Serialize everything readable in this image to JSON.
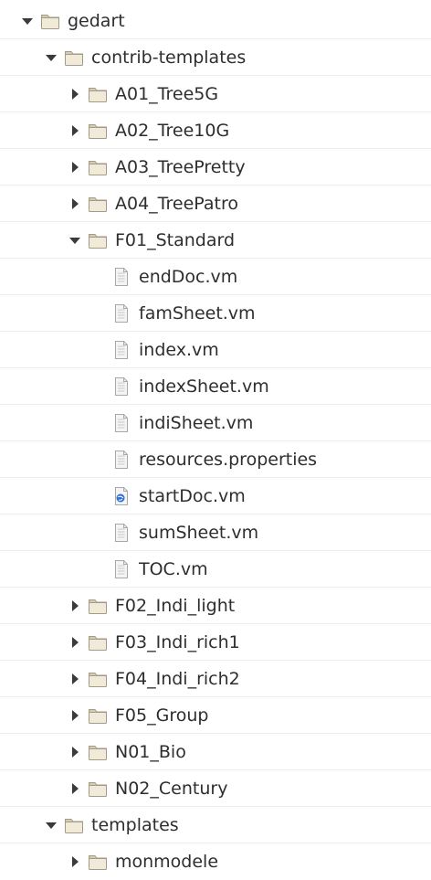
{
  "tree": {
    "items": [
      {
        "label": "gedart",
        "level": 0,
        "kind": "folder",
        "expanded": true,
        "icon": "folder-icon"
      },
      {
        "label": "contrib-templates",
        "level": 1,
        "kind": "folder",
        "expanded": true,
        "icon": "folder-icon"
      },
      {
        "label": "A01_Tree5G",
        "level": 2,
        "kind": "folder",
        "expanded": false,
        "icon": "folder-icon"
      },
      {
        "label": "A02_Tree10G",
        "level": 2,
        "kind": "folder",
        "expanded": false,
        "icon": "folder-icon"
      },
      {
        "label": "A03_TreePretty",
        "level": 2,
        "kind": "folder",
        "expanded": false,
        "icon": "folder-icon"
      },
      {
        "label": "A04_TreePatro",
        "level": 2,
        "kind": "folder",
        "expanded": false,
        "icon": "folder-icon"
      },
      {
        "label": "F01_Standard",
        "level": 2,
        "kind": "folder",
        "expanded": true,
        "icon": "folder-icon"
      },
      {
        "label": "endDoc.vm",
        "level": 3,
        "kind": "file",
        "icon": "text-file-icon"
      },
      {
        "label": "famSheet.vm",
        "level": 3,
        "kind": "file",
        "icon": "text-file-icon"
      },
      {
        "label": "index.vm",
        "level": 3,
        "kind": "file",
        "icon": "text-file-icon"
      },
      {
        "label": "indexSheet.vm",
        "level": 3,
        "kind": "file",
        "icon": "text-file-icon"
      },
      {
        "label": "indiSheet.vm",
        "level": 3,
        "kind": "file",
        "icon": "text-file-icon"
      },
      {
        "label": "resources.properties",
        "level": 3,
        "kind": "file",
        "icon": "text-file-icon"
      },
      {
        "label": "startDoc.vm",
        "level": 3,
        "kind": "file",
        "icon": "globe-file-icon"
      },
      {
        "label": "sumSheet.vm",
        "level": 3,
        "kind": "file",
        "icon": "text-file-icon"
      },
      {
        "label": "TOC.vm",
        "level": 3,
        "kind": "file",
        "icon": "text-file-icon"
      },
      {
        "label": "F02_Indi_light",
        "level": 2,
        "kind": "folder",
        "expanded": false,
        "icon": "folder-icon"
      },
      {
        "label": "F03_Indi_rich1",
        "level": 2,
        "kind": "folder",
        "expanded": false,
        "icon": "folder-icon"
      },
      {
        "label": "F04_Indi_rich2",
        "level": 2,
        "kind": "folder",
        "expanded": false,
        "icon": "folder-icon"
      },
      {
        "label": "F05_Group",
        "level": 2,
        "kind": "folder",
        "expanded": false,
        "icon": "folder-icon"
      },
      {
        "label": "N01_Bio",
        "level": 2,
        "kind": "folder",
        "expanded": false,
        "icon": "folder-icon"
      },
      {
        "label": "N02_Century",
        "level": 2,
        "kind": "folder",
        "expanded": false,
        "icon": "folder-icon"
      },
      {
        "label": "templates",
        "level": 1,
        "kind": "folder",
        "expanded": true,
        "icon": "folder-icon"
      },
      {
        "label": "monmodele",
        "level": 2,
        "kind": "folder",
        "expanded": false,
        "icon": "folder-icon"
      }
    ]
  },
  "colors": {
    "folder_tab": "#d6cbb0",
    "folder_body": "#f1ead8",
    "folder_stroke": "#a39a87",
    "file_body": "#f4f4f4",
    "file_stroke": "#a8a8a8",
    "globe": "#2f6fd6",
    "toggle": "#3a3a3a",
    "text": "#2e2e2e",
    "separator": "#ececec"
  }
}
